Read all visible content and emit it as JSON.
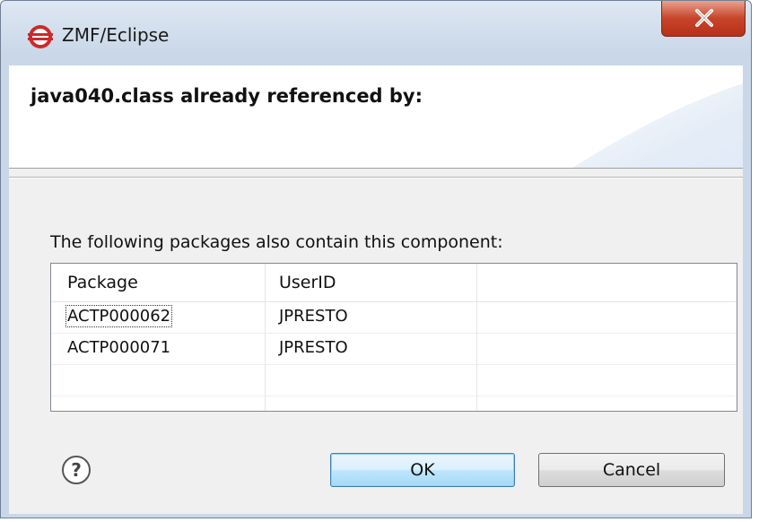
{
  "window": {
    "title": "ZMF/Eclipse",
    "close_symbol": "X"
  },
  "banner": {
    "title": "java040.class already referenced by:"
  },
  "message": "The following packages also contain this component:",
  "table": {
    "columns": [
      "Package",
      "UserID",
      ""
    ],
    "rows": [
      {
        "package": "ACTP000062",
        "userid": "JPRESTO"
      },
      {
        "package": "ACTP000071",
        "userid": "JPRESTO"
      }
    ]
  },
  "buttons": {
    "help_symbol": "?",
    "ok_label": "OK",
    "cancel_label": "Cancel"
  },
  "colors": {
    "title_icon": "#cc2a2a",
    "close_button": "#c7442a",
    "default_button_border": "#3c7fb1"
  }
}
